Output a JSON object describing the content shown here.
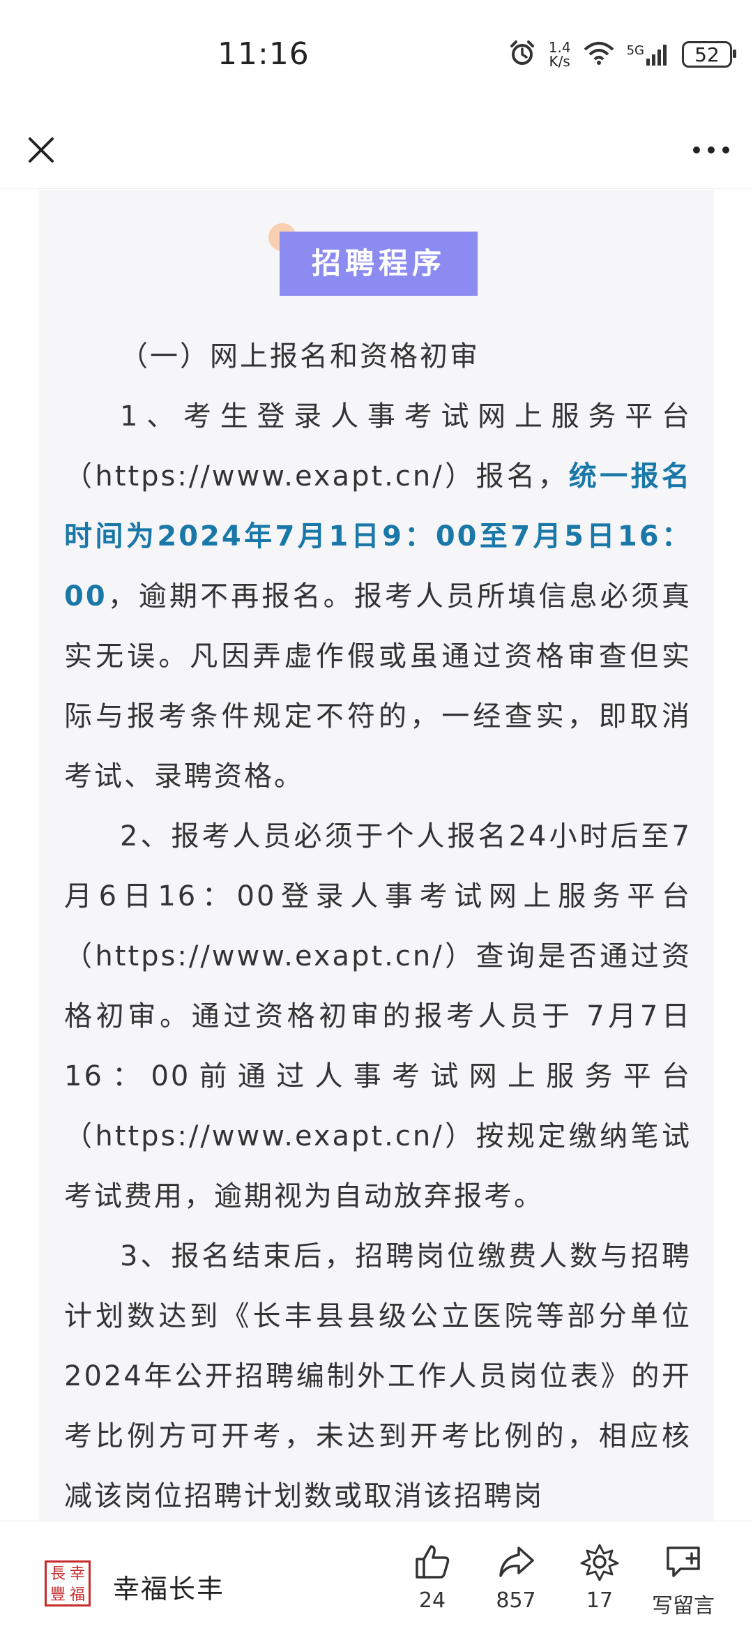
{
  "status_bar": {
    "time": "11:16",
    "speed_value": "1.4",
    "speed_unit": "K/s",
    "network": "5G",
    "battery": "52"
  },
  "article": {
    "section_title": "招聘程序",
    "subheading": "（一）网上报名和资格初审",
    "p1_start": "1、考生登录人事考试网上服务平台（https://www.exapt.cn/）报名，",
    "p1_highlight": "统一报名时间为2024年7月1日9：00至7月5日16：00",
    "p1_end": "，逾期不再报名。报考人员所填信息必须真实无误。凡因弄虚作假或虽通过资格审查但实际与报考条件规定不符的，一经查实，即取消考试、录聘资格。",
    "p2": "2、报考人员必须于个人报名24小时后至7月6日16：00登录人事考试网上服务平台（https://www.exapt.cn/）查询是否通过资格初审。通过资格初审的报考人员于 7月7日16：00前通过人事考试网上服务平台（https://www.exapt.cn/）按规定缴纳笔试考试费用，逾期视为自动放弃报考。",
    "p3": "3、报名结束后，招聘岗位缴费人数与招聘计划数达到《长丰县县级公立医院等部分单位2024年公开招聘编制外工作人员岗位表》的开考比例方可开考，未达到开考比例的，相应核减该岗位招聘计划数或取消该招聘岗"
  },
  "bottom_bar": {
    "account_logo_chars": [
      "幸",
      "福",
      "長",
      "豐"
    ],
    "account_name": "幸福长丰",
    "like_count": "24",
    "share_count": "857",
    "wow_count": "17",
    "comment_label": "写留言"
  }
}
